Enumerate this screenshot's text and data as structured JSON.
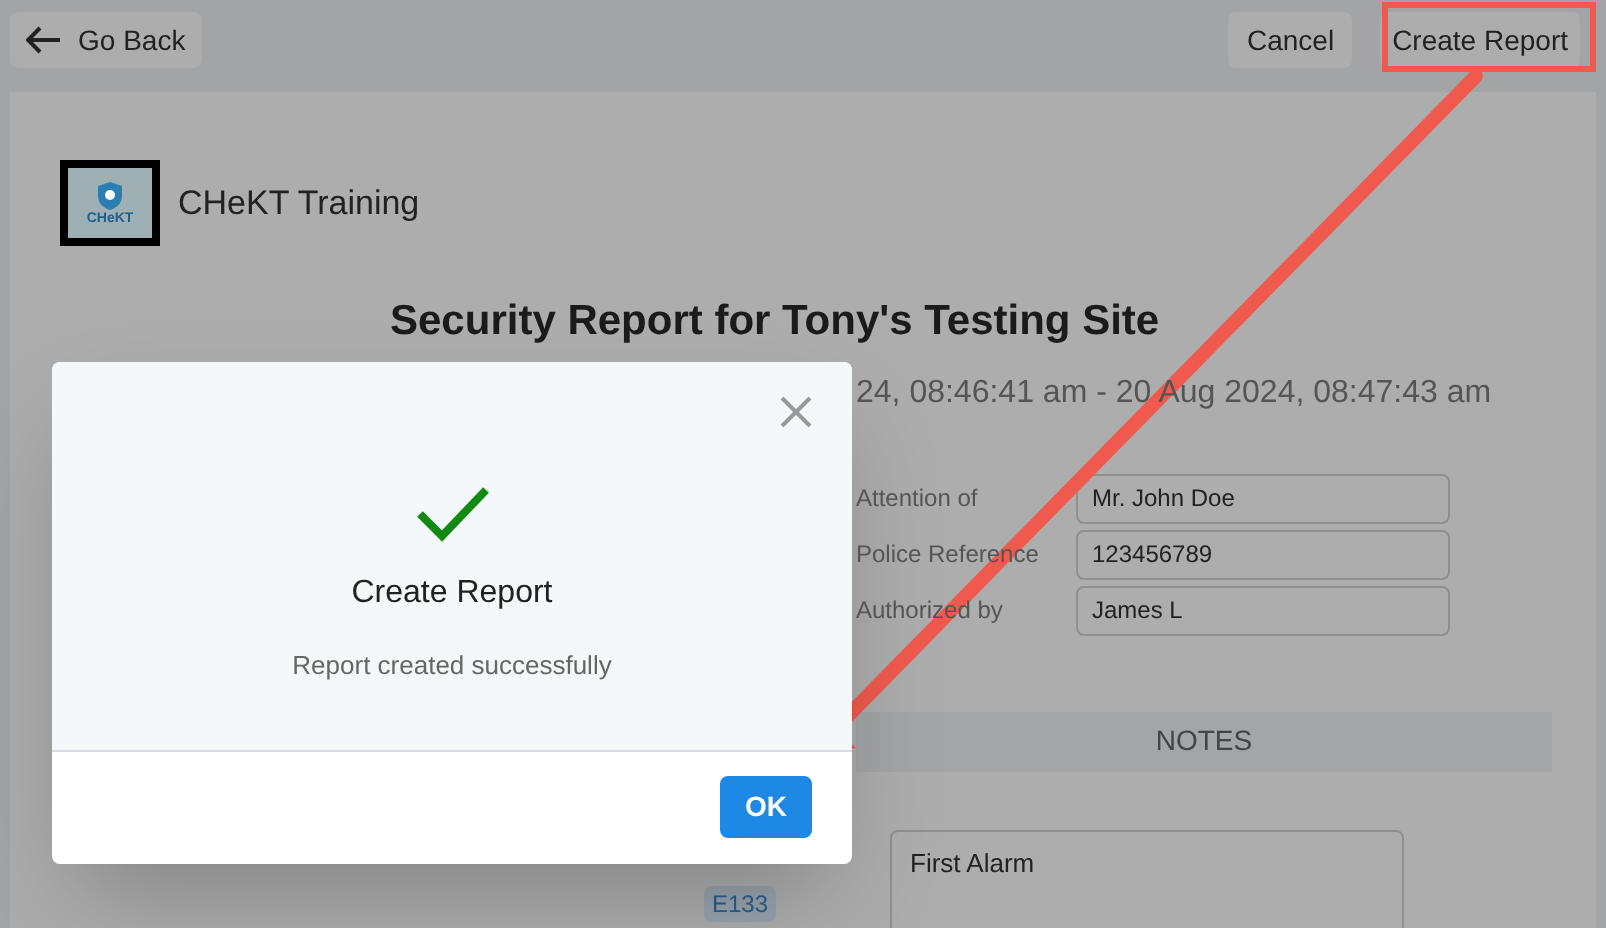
{
  "toolbar": {
    "back_button": "Go Back",
    "cancel_button": "Cancel",
    "create_button": "Create Report"
  },
  "report": {
    "company": "CHeKT Training",
    "logo_text": "CHeKT",
    "title": "Security Report for Tony's Testing Site",
    "period": "24, 08:46:41 am - 20 Aug 2024, 08:47:43 am",
    "fields": [
      {
        "label": "Attention of",
        "value": "Mr. John Doe"
      },
      {
        "label": "Police Reference",
        "value": "123456789"
      },
      {
        "label": "Authorized by",
        "value": "James L"
      }
    ],
    "notes_header": "NOTES",
    "event_code": "E133",
    "note": "First Alarm"
  },
  "dialog": {
    "title": "Create Report",
    "message": "Report created successfully",
    "ok_button": "OK"
  }
}
